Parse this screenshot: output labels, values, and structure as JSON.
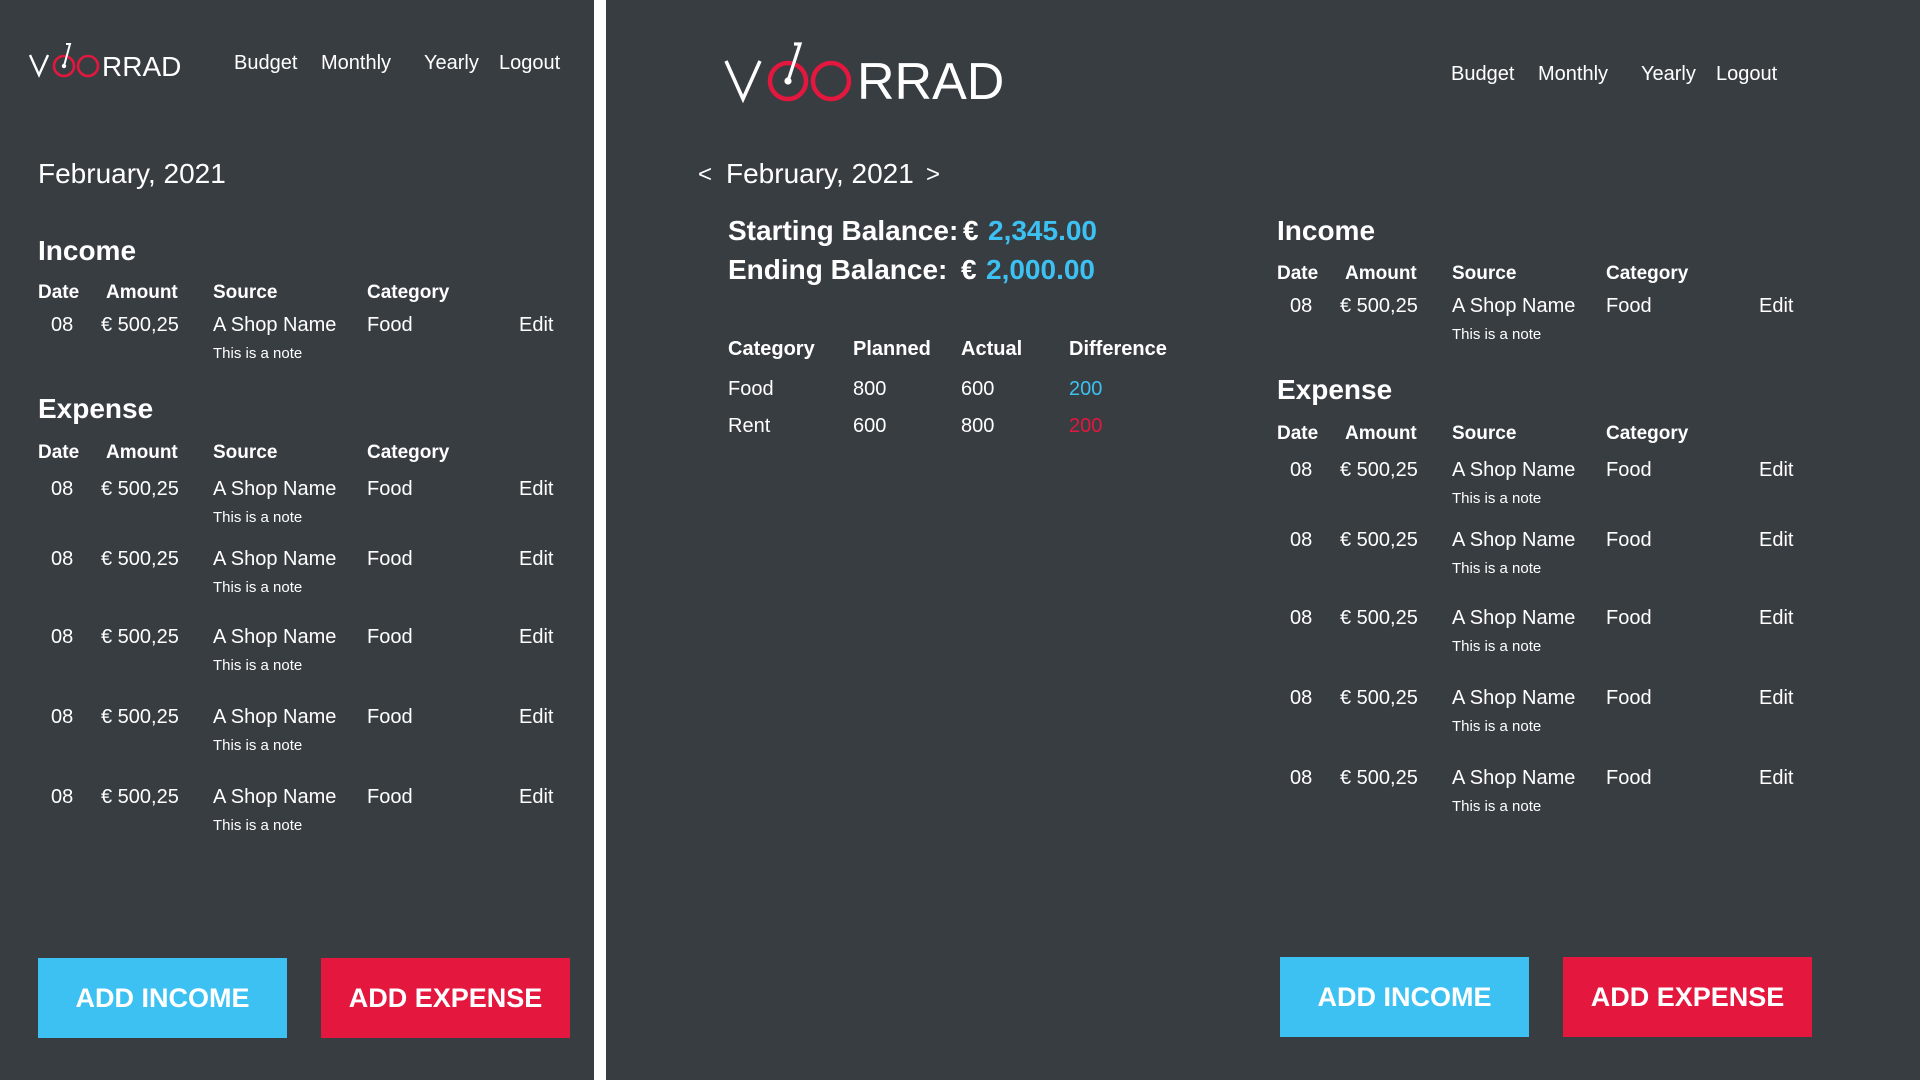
{
  "brand": {
    "name": "VOORRAD",
    "accent": "#e4173e",
    "positive": "#3cc1f2",
    "background": "#383d42"
  },
  "nav": [
    "Budget",
    "Monthly",
    "Yearly",
    "Logout"
  ],
  "month": "February, 2021",
  "month_prev": "<",
  "month_next": ">",
  "balances": {
    "start_label": "Starting Balance:",
    "start_currency": "€",
    "start_value": "2,345.00",
    "end_label": "Ending Balance:",
    "end_currency": "€",
    "end_value": "2,000.00"
  },
  "budget": {
    "headers": [
      "Category",
      "Planned",
      "Actual",
      "Difference"
    ],
    "rows": [
      {
        "category": "Food",
        "planned": "800",
        "actual": "600",
        "difference": "200",
        "status": "positive"
      },
      {
        "category": "Rent",
        "planned": "600",
        "actual": "800",
        "difference": "200",
        "status": "negative"
      }
    ]
  },
  "income": {
    "title": "Income",
    "headers": [
      "Date",
      "Amount",
      "Source",
      "Category"
    ],
    "rows": [
      {
        "date": "08",
        "amount": "€ 500,25",
        "source": "A Shop Name",
        "note": "This is a note",
        "category": "Food",
        "action": "Edit"
      }
    ]
  },
  "expense": {
    "title": "Expense",
    "headers": [
      "Date",
      "Amount",
      "Source",
      "Category"
    ],
    "rows": [
      {
        "date": "08",
        "amount": "€ 500,25",
        "source": "A Shop Name",
        "note": "This is a note",
        "category": "Food",
        "action": "Edit"
      },
      {
        "date": "08",
        "amount": "€ 500,25",
        "source": "A Shop Name",
        "note": "This is a note",
        "category": "Food",
        "action": "Edit"
      },
      {
        "date": "08",
        "amount": "€ 500,25",
        "source": "A Shop Name",
        "note": "This is a note",
        "category": "Food",
        "action": "Edit"
      },
      {
        "date": "08",
        "amount": "€ 500,25",
        "source": "A Shop Name",
        "note": "This is a note",
        "category": "Food",
        "action": "Edit"
      },
      {
        "date": "08",
        "amount": "€ 500,25",
        "source": "A Shop Name",
        "note": "This is a note",
        "category": "Food",
        "action": "Edit"
      }
    ]
  },
  "buttons": {
    "add_income": "ADD INCOME",
    "add_expense": "ADD EXPENSE"
  }
}
